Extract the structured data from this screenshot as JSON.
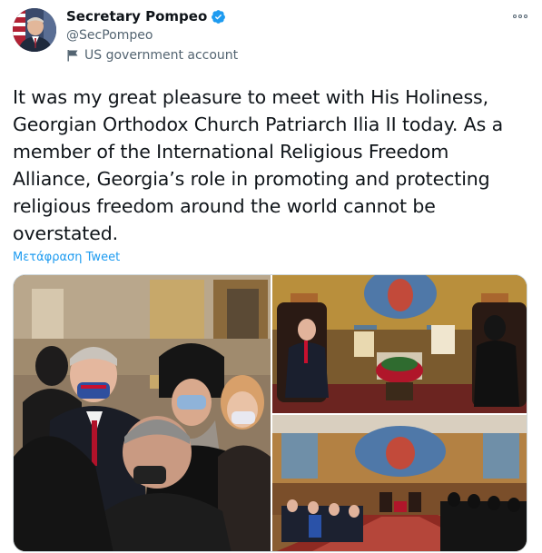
{
  "author": {
    "display_name": "Secretary Pompeo",
    "handle": "@SecPompeo",
    "account_label": "US government account"
  },
  "icons": {
    "verified": "verified-badge-icon",
    "government": "flag-icon",
    "more": "more-options-icon"
  },
  "colors": {
    "accent": "#1d9bf0",
    "text": "#0f1419",
    "secondary": "#536471"
  },
  "tweet": {
    "lines": [
      "It was my great pleasure to meet with His Holiness,",
      "Georgian Orthodox Church Patriarch Ilia II today. As a",
      "member of the International Religious Freedom",
      "Alliance, Georgia’s role in promoting and protecting",
      "religious freedom around the world cannot be",
      "overstated."
    ],
    "translate_label": "Μετάφραση Tweet"
  }
}
